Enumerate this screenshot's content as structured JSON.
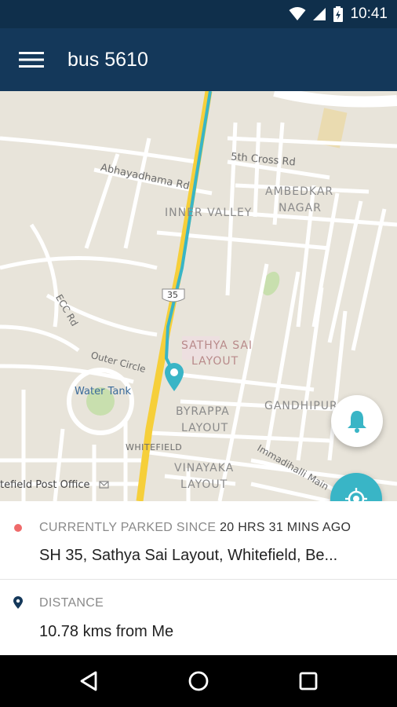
{
  "status_bar": {
    "time": "10:41",
    "icons": [
      "wifi-icon",
      "signal-icon",
      "battery-icon"
    ]
  },
  "app_bar": {
    "title": "bus 5610",
    "menu_icon": "hamburger-menu-icon"
  },
  "map": {
    "labels": {
      "fifth_cross": "5th Cross Rd",
      "abhayadhama": "Abhayadhama Rd",
      "inner_valley": "INNER VALLEY",
      "ambedkar": "AMBEDKAR",
      "nagar": "NAGAR",
      "shield": "35",
      "ecc": "ECC Rd",
      "sathya_sai": "SATHYA SAI",
      "layout1": "LAYOUT",
      "outer_circle": "Outer Circle",
      "water_tank": "Water Tank",
      "byrappa": "BYRAPPA",
      "layout2": "LAYOUT",
      "gandhipura": "GANDHIPURA",
      "whitefield": "WHITEFIELD",
      "immadihalli": "Immadihalli Main",
      "vinayaka": "VINAYAKA",
      "layout3": "LAYOUT",
      "post_office": "tefield Post Office"
    },
    "fab_bell_icon": "bell-icon",
    "fab_locate_icon": "my-location-icon",
    "colors": {
      "route_yellow": "#f6cf3a",
      "route_blue": "#39b5c6",
      "marker": "#39b5c6"
    }
  },
  "parked": {
    "label": "CURRENTLY PARKED SINCE",
    "since": "20 HRS 31 MINS AGO",
    "address": "SH 35, Sathya Sai Layout, Whitefield, Be..."
  },
  "distance": {
    "label": "DISTANCE",
    "value": "10.78 kms from Me"
  },
  "nav": {
    "back_icon": "back-icon",
    "home_icon": "home-icon",
    "recent_icon": "recent-apps-icon"
  }
}
